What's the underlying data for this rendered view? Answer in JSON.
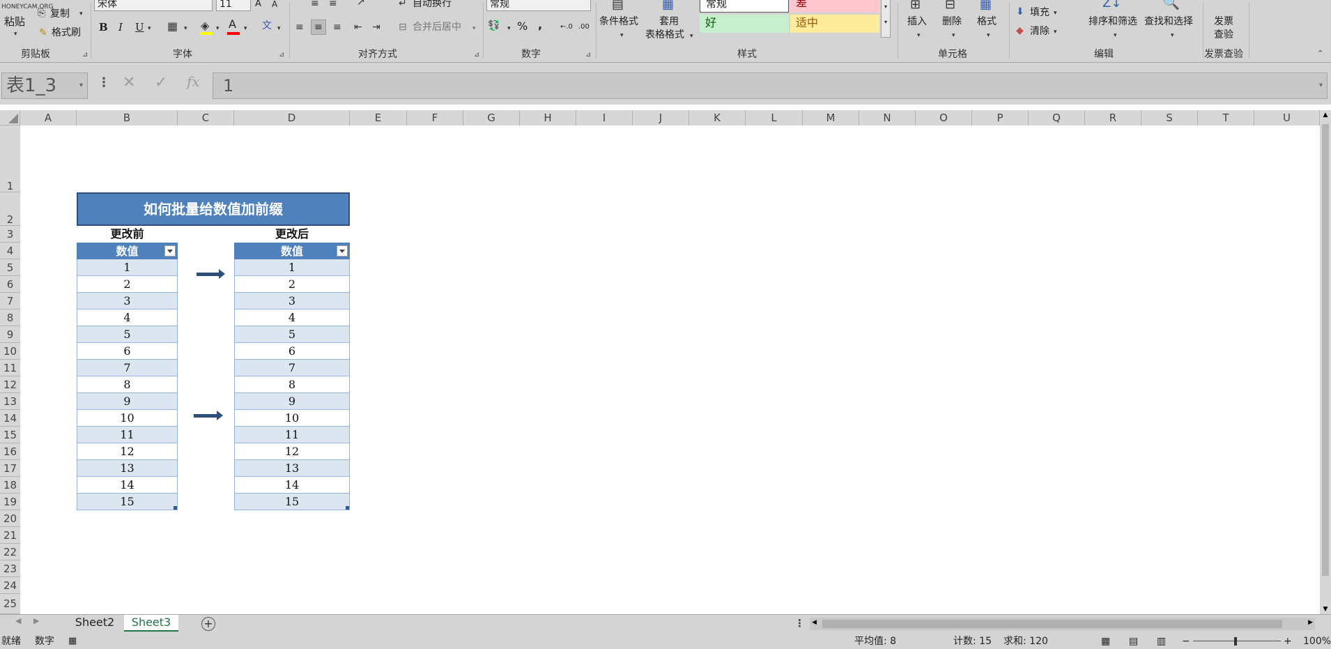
{
  "watermark": "HONEYCAM.ORG",
  "ribbon": {
    "clipboard": {
      "paste": "粘贴",
      "copy": "复制",
      "format_painter": "格式刷",
      "label": "剪贴板"
    },
    "font": {
      "name": "宋体",
      "size": "11",
      "label": "字体"
    },
    "alignment": {
      "wrap": "自动换行",
      "merge": "合并后居中",
      "label": "对齐方式"
    },
    "number": {
      "format": "常规",
      "label": "数字"
    },
    "styles": {
      "cond_format": "条件格式",
      "table_format_1": "套用",
      "table_format_2": "表格格式",
      "normal": "常规",
      "bad": "差",
      "good": "好",
      "neutral": "适中",
      "label": "样式"
    },
    "cells": {
      "insert": "插入",
      "delete": "删除",
      "format": "格式",
      "label": "单元格"
    },
    "editing": {
      "fill": "填充",
      "clear": "清除",
      "sort_filter": "排序和筛选",
      "find_select": "查找和选择",
      "label": "编辑"
    },
    "invoice": {
      "check_1": "发票",
      "check_2": "查验",
      "label": "发票查验"
    }
  },
  "formula_bar": {
    "name_box": "表1_3",
    "value": "1"
  },
  "columns": [
    "A",
    "B",
    "C",
    "D",
    "E",
    "F",
    "G",
    "H",
    "I",
    "J",
    "K",
    "L",
    "M",
    "N",
    "O",
    "P",
    "Q",
    "R",
    "S",
    "T",
    "U"
  ],
  "rows": [
    "1",
    "2",
    "3",
    "4",
    "5",
    "6",
    "7",
    "8",
    "9",
    "10",
    "11",
    "12",
    "13",
    "14",
    "15",
    "16",
    "17",
    "18",
    "19",
    "20",
    "21",
    "22",
    "23",
    "24",
    "25"
  ],
  "sheet": {
    "title": "如何批量给数值加前缀",
    "before_label": "更改前",
    "after_label": "更改后",
    "table_header": "数值",
    "before_values": [
      "1",
      "2",
      "3",
      "4",
      "5",
      "6",
      "7",
      "8",
      "9",
      "10",
      "11",
      "12",
      "13",
      "14",
      "15"
    ],
    "after_values": [
      "1",
      "2",
      "3",
      "4",
      "5",
      "6",
      "7",
      "8",
      "9",
      "10",
      "11",
      "12",
      "13",
      "14",
      "15"
    ]
  },
  "tabs": [
    "Sheet2",
    "Sheet3"
  ],
  "active_tab": "Sheet3",
  "status": {
    "ready": "就绪",
    "mode": "数字",
    "average": "平均值: 8",
    "count": "计数: 15",
    "sum": "求和: 120",
    "zoom": "100%"
  },
  "colors": {
    "accent": "#4f81bd",
    "band": "#dce6f1",
    "tab_active": "#217346"
  }
}
